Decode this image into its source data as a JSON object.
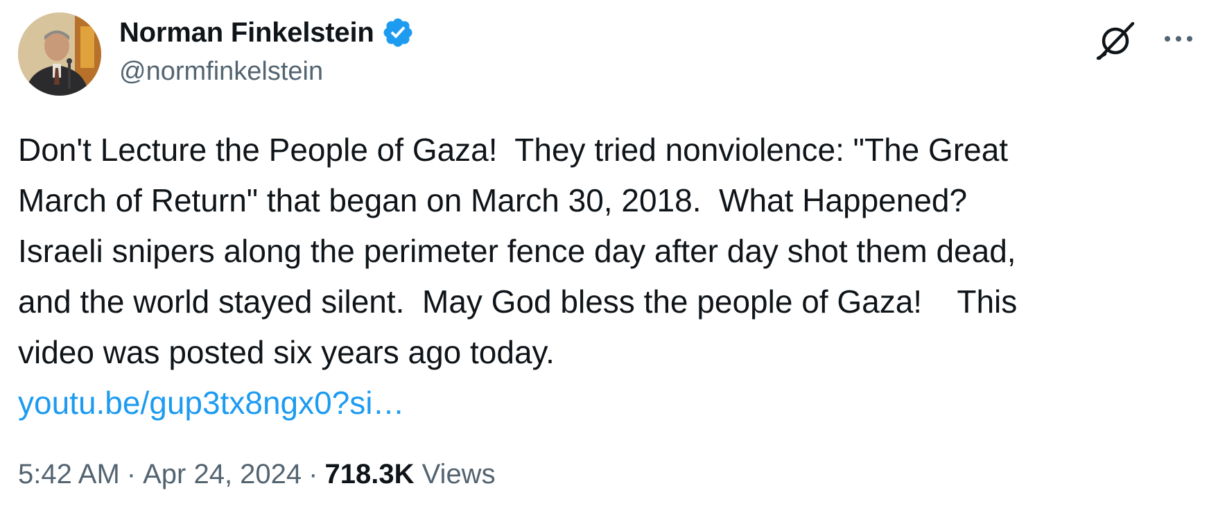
{
  "author": {
    "display_name": "Norman Finkelstein",
    "handle": "@normfinkelstein",
    "verified": true,
    "avatar_icon": "profile-photo"
  },
  "tweet": {
    "text": "Don't Lecture the People of Gaza!  They tried nonviolence: \"The Great March of Return\" that began on March 30, 2018.  What Happened? Israeli snipers along the perimeter fence day after day shot them dead, and the world stayed silent.  May God bless the people of Gaza!    This video was posted six years ago today.",
    "text_lines": [
      "Don't Lecture the People of Gaza!  They tried nonviolence: \"The Great",
      "March of Return\" that began on March 30, 2018.  What Happened?",
      "Israeli snipers along the perimeter fence day after day shot them dead,",
      "and the world stayed silent.  May God bless the people of Gaza!    This",
      "video was posted six years ago today."
    ],
    "link": "youtu.be/gup3tx8ngx0?si…"
  },
  "meta": {
    "time": "5:42 AM",
    "separator": "·",
    "date": "Apr 24, 2024",
    "views_count": "718.3K",
    "views_label": "Views"
  },
  "icons": {
    "grok": "grok-icon",
    "more": "more-options-icon",
    "verified": "verified-badge-icon"
  },
  "colors": {
    "text": "#0f1419",
    "secondary": "#536471",
    "link": "#1d9bf0",
    "verified": "#1d9bf0"
  }
}
